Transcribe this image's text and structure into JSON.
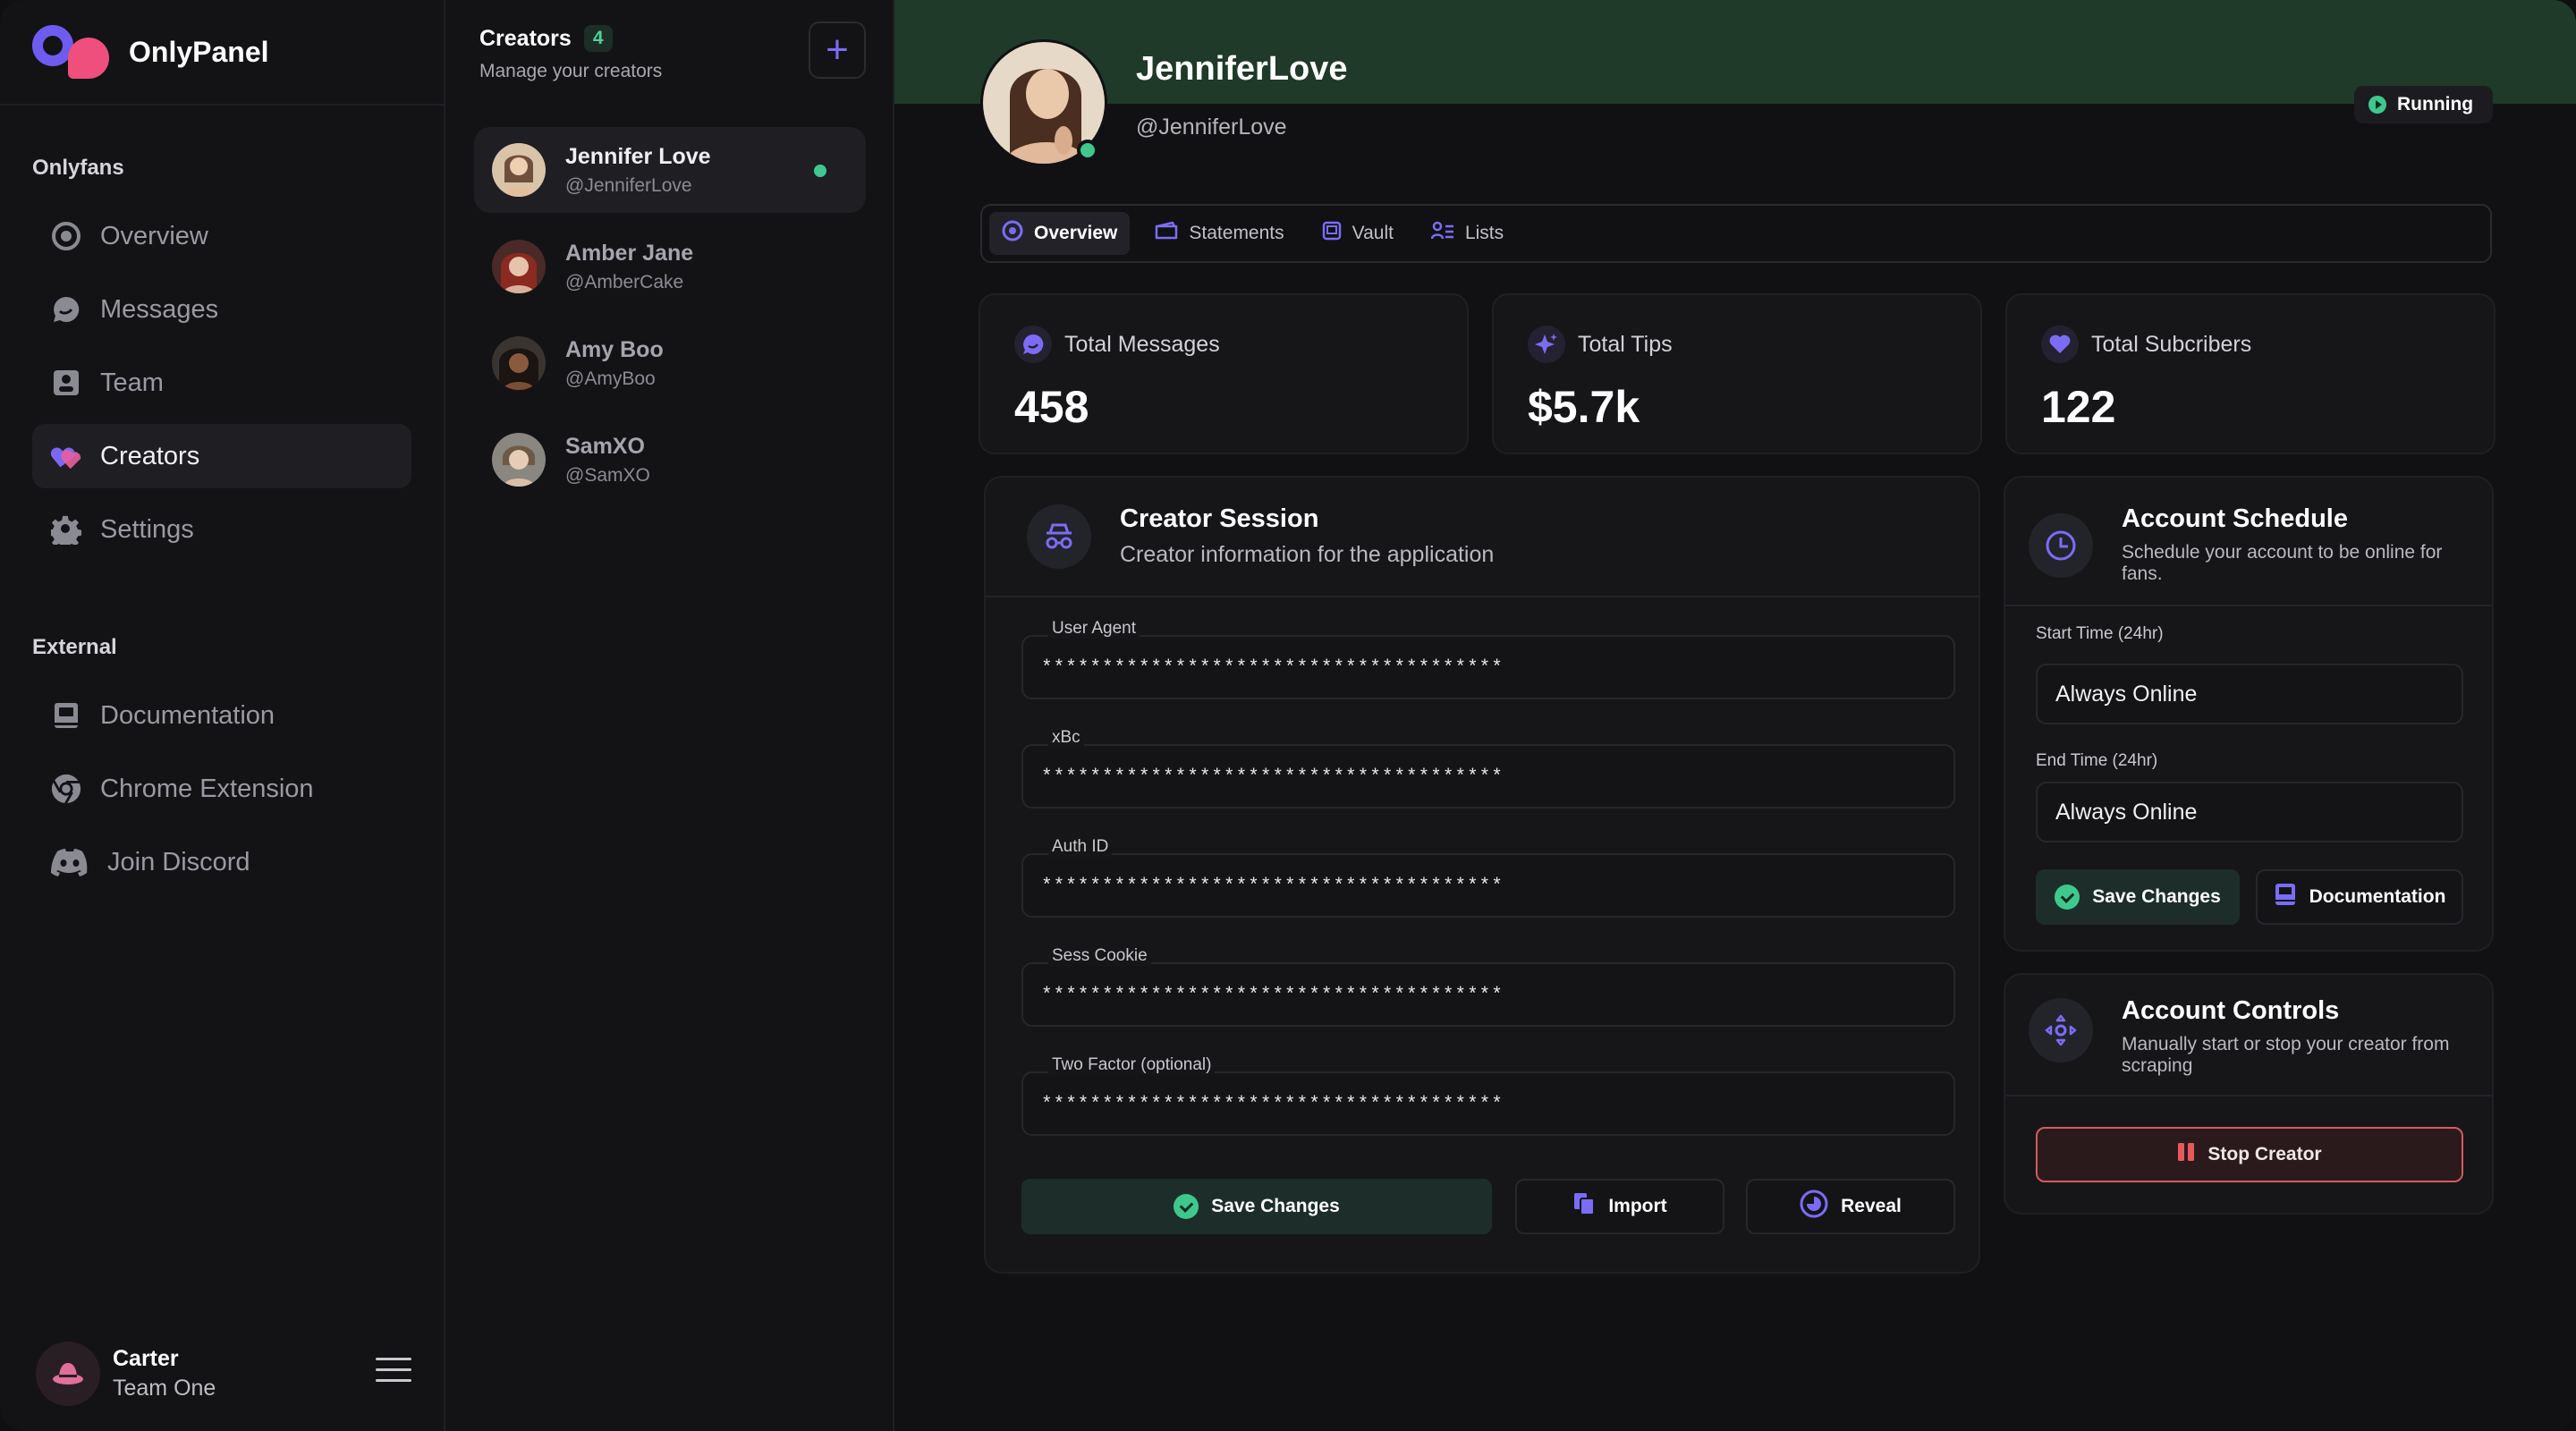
{
  "brand": {
    "name": "OnlyPanel"
  },
  "sidebar": {
    "section_onlyfans": "Onlyfans",
    "section_external": "External",
    "items": [
      {
        "label": "Overview",
        "icon": "overview-icon"
      },
      {
        "label": "Messages",
        "icon": "messages-icon"
      },
      {
        "label": "Team",
        "icon": "team-icon"
      },
      {
        "label": "Creators",
        "icon": "creators-icon",
        "active": true
      },
      {
        "label": "Settings",
        "icon": "settings-icon"
      }
    ],
    "external": [
      {
        "label": "Documentation",
        "icon": "documentation-icon"
      },
      {
        "label": "Chrome Extension",
        "icon": "chrome-icon"
      },
      {
        "label": "Join Discord",
        "icon": "discord-icon"
      }
    ],
    "user": {
      "name": "Carter",
      "team": "Team One"
    }
  },
  "creators_panel": {
    "title": "Creators",
    "count": "4",
    "subtitle": "Manage your creators",
    "add_label": "+",
    "list": [
      {
        "name": "Jennifer Love",
        "handle": "@JenniferLove",
        "online": true
      },
      {
        "name": "Amber Jane",
        "handle": "@AmberCake"
      },
      {
        "name": "Amy Boo",
        "handle": "@AmyBoo"
      },
      {
        "name": "SamXO",
        "handle": "@SamXO"
      }
    ]
  },
  "profile": {
    "name": "JenniferLove",
    "handle": "@JenniferLove",
    "status": "Running"
  },
  "tabs": [
    {
      "label": "Overview",
      "icon": "overview-icon",
      "active": true
    },
    {
      "label": "Statements",
      "icon": "wallet-icon"
    },
    {
      "label": "Vault",
      "icon": "vault-icon"
    },
    {
      "label": "Lists",
      "icon": "list-icon"
    }
  ],
  "stats": [
    {
      "label": "Total Messages",
      "value": "458",
      "icon": "message-icon"
    },
    {
      "label": "Total Tips",
      "value": "$5.7k",
      "icon": "sparkle-icon"
    },
    {
      "label": "Total Subcribers",
      "value": "122",
      "icon": "heart-icon"
    }
  ],
  "session": {
    "title": "Creator Session",
    "subtitle": "Creator information for the application",
    "fields": [
      {
        "label": "User Agent",
        "value": "**************************************"
      },
      {
        "label": "xBc",
        "value": "**************************************"
      },
      {
        "label": "Auth ID",
        "value": "**************************************"
      },
      {
        "label": "Sess Cookie",
        "value": "**************************************"
      },
      {
        "label": "Two Factor (optional)",
        "value": "**************************************"
      }
    ],
    "save_label": "Save Changes",
    "import_label": "Import",
    "reveal_label": "Reveal"
  },
  "schedule": {
    "title": "Account Schedule",
    "subtitle": "Schedule your account to be online for fans.",
    "start_label": "Start Time (24hr)",
    "start_value": "Always Online",
    "end_label": "End Time (24hr)",
    "end_value": "Always Online",
    "save_label": "Save Changes",
    "docs_label": "Documentation"
  },
  "controls": {
    "title": "Account Controls",
    "subtitle": "Manually start or stop your creator from scraping",
    "stop_label": "Stop Creator"
  },
  "colors": {
    "accent": "#6e5bf0",
    "brand_pink": "#ef4f7c",
    "online": "#3fc88d",
    "banner": "#1f3a28",
    "danger": "#d45b5b"
  }
}
